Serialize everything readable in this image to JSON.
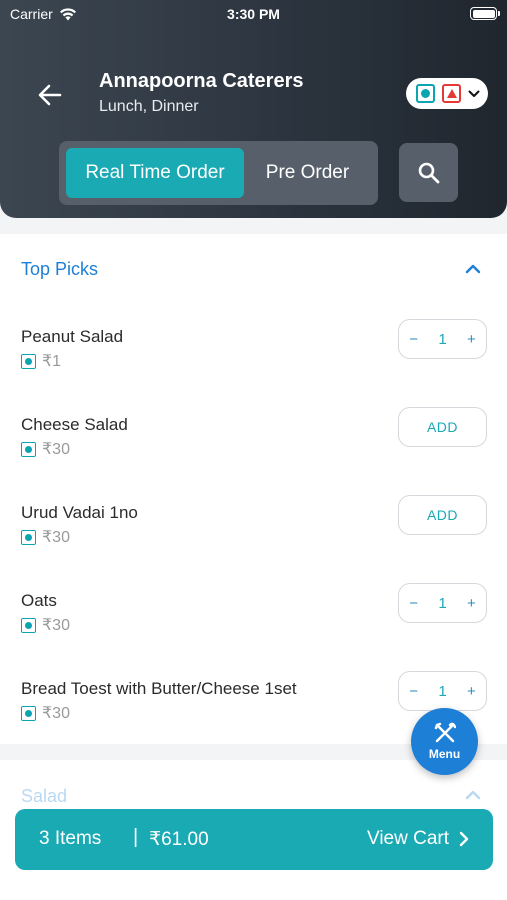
{
  "status_bar": {
    "carrier": "Carrier",
    "time": "3:30 PM"
  },
  "header": {
    "title": "Annapoorna Caterers",
    "subtitle": "Lunch, Dinner",
    "order_modes": [
      "Real Time Order",
      "Pre Order"
    ],
    "active_mode": "Real Time Order"
  },
  "colors": {
    "accent": "#1aaab4",
    "link": "#1e7fd6",
    "veg": "#0aa5b1",
    "non_veg": "#e53935",
    "header_dark": "#2f3843"
  },
  "icons": {
    "back": "arrow-left-icon",
    "search": "search-icon",
    "menu": "fork-knife-icon",
    "cart_next": "chevron-right-icon"
  },
  "sections": [
    {
      "title": "Top Picks",
      "expanded": true,
      "items": [
        {
          "name": "Peanut Salad",
          "price": "₹1",
          "quantity": "1",
          "action": "qty"
        },
        {
          "name": "Cheese Salad",
          "price": "₹30",
          "action": "ADD"
        },
        {
          "name": "Urud Vadai 1no",
          "price": "₹30",
          "action": "ADD"
        },
        {
          "name": "Oats",
          "price": "₹30",
          "quantity": "1",
          "action": "qty"
        },
        {
          "name": "Bread Toest with Butter/Cheese 1set",
          "price": "₹30",
          "quantity": "1",
          "action": "qty"
        }
      ]
    },
    {
      "title": "Salad",
      "expanded": true
    }
  ],
  "menu_fab": {
    "label": "Menu"
  },
  "cart": {
    "count_label": "3 Items",
    "separator": "|",
    "total": "₹61.00",
    "action_label": "View Cart"
  }
}
